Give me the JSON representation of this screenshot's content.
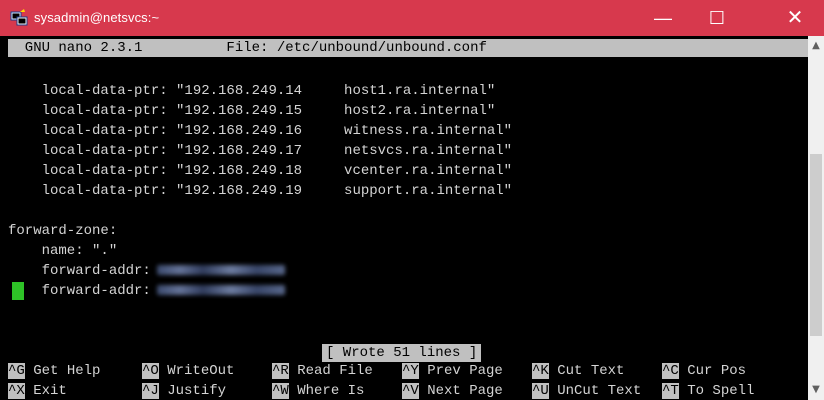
{
  "window": {
    "title": "sysadmin@netsvcs:~",
    "minimize_glyph": "—",
    "maximize_glyph": "☐",
    "close_glyph": "✕"
  },
  "nano": {
    "header": "  GNU nano 2.3.1          File: /etc/unbound/unbound.conf",
    "lines": [
      "    local-data-ptr: \"192.168.249.14     host1.ra.internal\"",
      "    local-data-ptr: \"192.168.249.15     host2.ra.internal\"",
      "    local-data-ptr: \"192.168.249.16     witness.ra.internal\"",
      "    local-data-ptr: \"192.168.249.17     netsvcs.ra.internal\"",
      "    local-data-ptr: \"192.168.249.18     vcenter.ra.internal\"",
      "    local-data-ptr: \"192.168.249.19     support.ra.internal\"",
      "",
      "forward-zone:",
      "    name: \".\"",
      "    forward-addr:",
      "    forward-addr:"
    ],
    "status_message": "[ Wrote 51 lines ]",
    "shortcuts": [
      [
        {
          "key": "^G",
          "label": " Get Help"
        },
        {
          "key": "^O",
          "label": " WriteOut"
        },
        {
          "key": "^R",
          "label": " Read File"
        },
        {
          "key": "^Y",
          "label": " Prev Page"
        },
        {
          "key": "^K",
          "label": " Cut Text"
        },
        {
          "key": "^C",
          "label": " Cur Pos"
        }
      ],
      [
        {
          "key": "^X",
          "label": " Exit"
        },
        {
          "key": "^J",
          "label": " Justify"
        },
        {
          "key": "^W",
          "label": " Where Is"
        },
        {
          "key": "^V",
          "label": " Next Page"
        },
        {
          "key": "^U",
          "label": " UnCut Text"
        },
        {
          "key": "^T",
          "label": " To Spell"
        }
      ]
    ]
  },
  "colors": {
    "titlebar": "#d7394d",
    "terminal_bg": "#000000",
    "terminal_text": "#d4d4d4",
    "highlight_bg": "#c0c0c0",
    "cursor": "#2ec227"
  },
  "icons": {
    "app_icon": "putty-icon",
    "scroll_up": "scroll-up-icon",
    "scroll_down": "scroll-down-icon"
  },
  "scrollbar": {
    "up_glyph": "▲",
    "down_glyph": "▼"
  }
}
